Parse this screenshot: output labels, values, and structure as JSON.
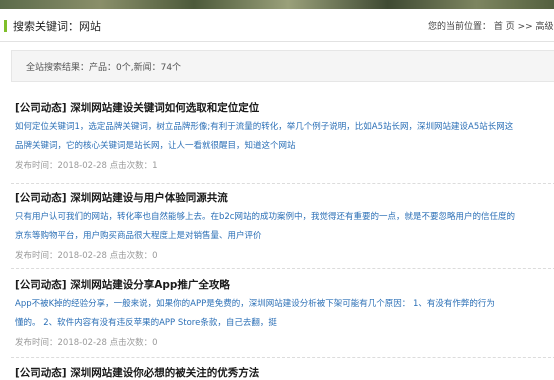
{
  "header": {
    "search_label": "搜索关键词：网站",
    "breadcrumb": "您的当前位置： 首 页 >> 高级"
  },
  "summary": {
    "text": "全站搜索结果：产品：0个,新闻：74个"
  },
  "articles": [
    {
      "title": "[公司动态] 深圳网站建设关键词如何选取和定位定位",
      "lines": [
        "如何定位关键词1，选定品牌关键词，树立品牌形像;有利于流量的转化，举几个例子说明，比如A5站长网，深圳网站建设A5站长网这",
        "品牌关键词，它的核心关键词是站长网，让人一看就很醒目，知道这个网站"
      ],
      "meta": "发布时间：2018-02-28  点击次数：1"
    },
    {
      "title": "[公司动态] 深圳网站建设与用户体验同源共流",
      "lines": [
        "只有用户认可我们的网站，转化率也自然能够上去。在b2c网站的成功案例中，我觉得还有重要的一点，就是不要忽略用户的信任度的",
        "京东等购物平台，用户购买商品很大程度上是对销售量、用户评价"
      ],
      "meta": "发布时间：2018-02-28  点击次数：0"
    },
    {
      "title": "[公司动态] 深圳网站建设分享App推广全攻略",
      "lines": [
        "App不被K掉的经验分享，一般来说，如果你的APP是免费的，深圳网站建设分析被下架可能有几个原因：    1、有没有作弊的行为",
        "懂的。    2、软件内容有没有违反苹果的APP Store条款，自己去翻，挺"
      ],
      "meta": "发布时间：2018-02-28  点击次数：0"
    },
    {
      "title": "[公司动态] 深圳网站建设你必想的被关注的优秀方法",
      "lines": [],
      "meta": ""
    }
  ]
}
